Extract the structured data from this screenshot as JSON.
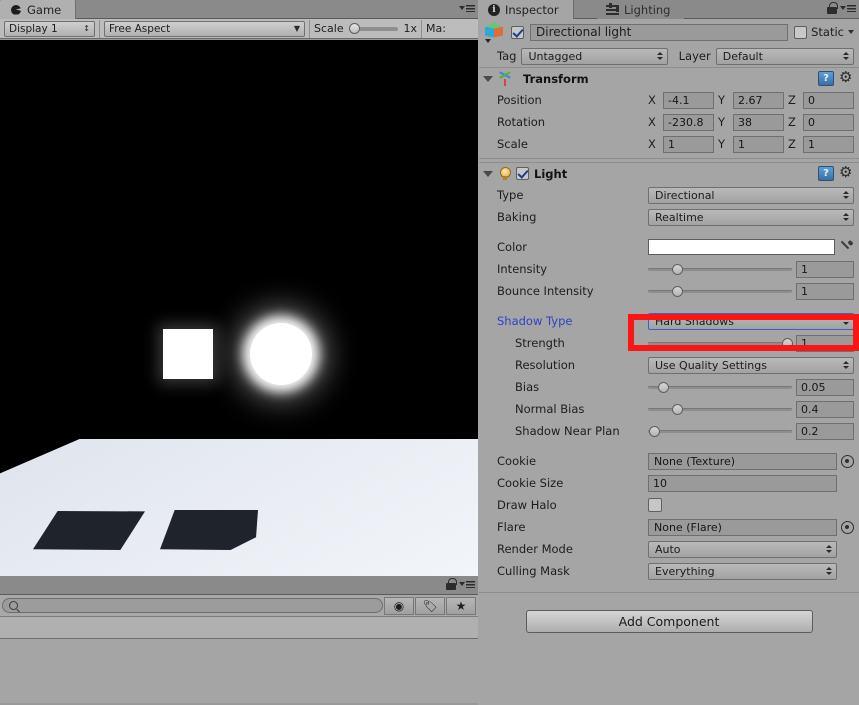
{
  "game_panel": {
    "tab_label": "Game",
    "tab_icon": "game-icon",
    "menu_icon": "panel-menu-icon",
    "toolbar": {
      "display": "Display 1",
      "aspect": "Free Aspect",
      "scale_label": "Scale",
      "scale_value": "1x",
      "maximize_label": "Ma:"
    },
    "bottom": {
      "lock_icon": "lock-icon",
      "menu_icon": "panel-menu-icon",
      "search_placeholder": "",
      "search_value": "",
      "filter_icons": [
        "shapes-filter-icon",
        "tag-filter-icon",
        "favorite-star-icon"
      ]
    },
    "render": {
      "description": "Game view: white cube, glowing sphere, lit plane with two hard shadows",
      "background_color": "#000000",
      "floor_color": "#e9edf3",
      "shadow_color": "#1e232c"
    }
  },
  "inspector": {
    "tabs": [
      {
        "label": "Inspector",
        "icon": "info-icon",
        "active": true
      },
      {
        "label": "Lighting",
        "icon": "lighting-icon",
        "active": false
      }
    ],
    "lock_icon": "lock-icon",
    "menu_icon": "panel-menu-icon",
    "object": {
      "icon": "gameobject-cube-icon",
      "enabled": true,
      "name": "Directional light",
      "static_label": "Static",
      "static_checked": false,
      "tag_label": "Tag",
      "tag_value": "Untagged",
      "layer_label": "Layer",
      "layer_value": "Default"
    },
    "transform": {
      "title": "Transform",
      "icon": "transform-axes-icon",
      "help_icon": "help-book-icon",
      "settings_icon": "gear-icon",
      "expanded": true,
      "rows": [
        {
          "label": "Position",
          "x": "-4.1",
          "y": "2.67",
          "z": "0"
        },
        {
          "label": "Rotation",
          "x": "-230.8",
          "y": "38",
          "z": "0"
        },
        {
          "label": "Scale",
          "x": "1",
          "y": "1",
          "z": "1"
        }
      ],
      "axis_labels": {
        "x": "X",
        "y": "Y",
        "z": "Z"
      }
    },
    "light": {
      "title": "Light",
      "icon": "light-bulb-icon",
      "enabled": true,
      "help_icon": "help-book-icon",
      "settings_icon": "gear-icon",
      "expanded": true,
      "type_label": "Type",
      "type_value": "Directional",
      "baking_label": "Baking",
      "baking_value": "Realtime",
      "color_label": "Color",
      "color_value": "#ffffff",
      "eyedropper_icon": "eyedropper-icon",
      "intensity_label": "Intensity",
      "intensity_value": "1",
      "intensity_slider_pct": 17,
      "bounce_label": "Bounce Intensity",
      "bounce_value": "1",
      "bounce_slider_pct": 17,
      "shadow_type_label": "Shadow Type",
      "shadow_type_value": "Hard Shadows",
      "shadow_type_highlighted": true,
      "highlight_color": "#fb1616",
      "strength_label": "Strength",
      "strength_value": "1",
      "strength_slider_pct": 93,
      "resolution_label": "Resolution",
      "resolution_value": "Use Quality Settings",
      "bias_label": "Bias",
      "bias_value": "0.05",
      "bias_slider_pct": 7,
      "normal_bias_label": "Normal Bias",
      "normal_bias_value": "0.4",
      "normal_bias_slider_pct": 17,
      "near_plane_label": "Shadow Near Plan",
      "near_plane_value": "0.2",
      "near_plane_slider_pct": 1,
      "cookie_label": "Cookie",
      "cookie_value": "None (Texture)",
      "cookie_size_label": "Cookie Size",
      "cookie_size_value": "10",
      "draw_halo_label": "Draw Halo",
      "draw_halo_checked": false,
      "flare_label": "Flare",
      "flare_value": "None (Flare)",
      "render_mode_label": "Render Mode",
      "render_mode_value": "Auto",
      "culling_label": "Culling Mask",
      "culling_value": "Everything",
      "object_picker_icon": "object-picker-icon"
    },
    "add_component_label": "Add Component"
  }
}
